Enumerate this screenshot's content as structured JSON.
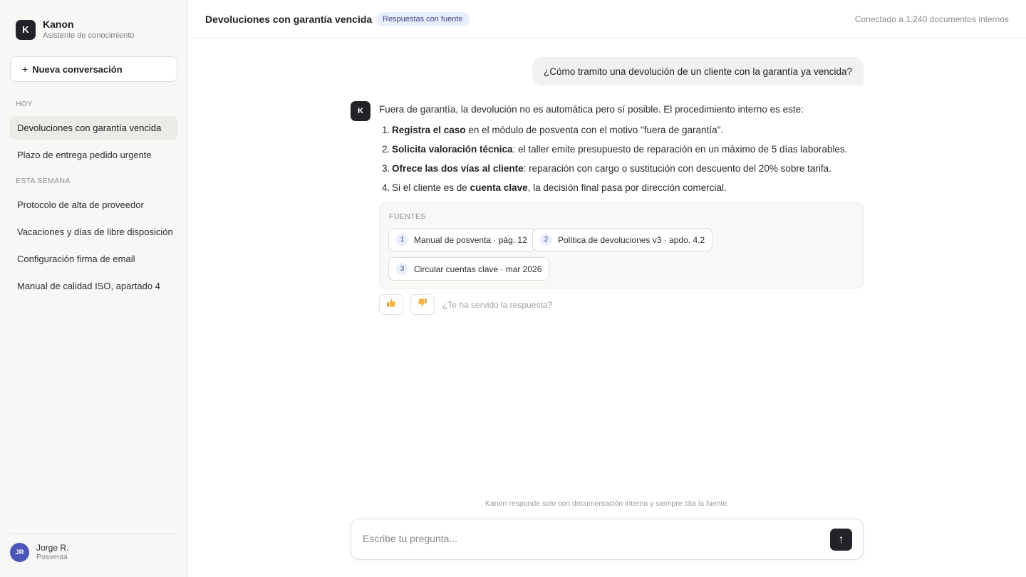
{
  "app": {
    "logo_letter": "K",
    "name": "Kanon",
    "subtitle": "Asistente de conocimiento"
  },
  "sidebar": {
    "new_conversation_plus": "+",
    "new_conversation_label": "Nueva conversación",
    "sections": [
      {
        "label": "HOY",
        "items": [
          {
            "label": "Devoluciones con garantía vencida",
            "active": true
          },
          {
            "label": "Plazo de entrega pedido urgente",
            "active": false
          }
        ]
      },
      {
        "label": "ESTA SEMANA",
        "items": [
          {
            "label": "Protocolo de alta de proveedor",
            "active": false
          },
          {
            "label": "Vacaciones y días de libre disposición",
            "active": false
          },
          {
            "label": "Configuración firma de email",
            "active": false
          },
          {
            "label": "Manual de calidad ISO, apartado 4",
            "active": false
          }
        ]
      }
    ],
    "user": {
      "initials": "JR",
      "name": "Jorge R.",
      "role": "Posventa"
    }
  },
  "header": {
    "title": "Devoluciones con garantía vencida",
    "badge": "Respuestas con fuente",
    "status": "Conectado a 1.240 documentos internos"
  },
  "chat": {
    "user_message": "¿Cómo tramito una devolución de un cliente con la garantía ya vencida?",
    "assistant_avatar": "K",
    "answer_intro": "Fuera de garantía, la devolución no es automática pero sí posible. El procedimiento interno es este:",
    "steps": [
      {
        "num": "1.",
        "bold": "Registra el caso",
        "text": " en el módulo de posventa con el motivo \"fuera de garantía\"."
      },
      {
        "num": "2.",
        "bold": "Solicita valoración técnica",
        "text": ": el taller emite presupuesto de reparación en un máximo de 5 días laborables."
      },
      {
        "num": "3.",
        "bold": "Ofrece las dos vías al cliente",
        "text": ": reparación con cargo o sustitución con descuento del 20% sobre tarifa."
      },
      {
        "num": "4.",
        "pre": "Si el cliente es de ",
        "bold": "cuenta clave",
        "text": ", la decisión final pasa por dirección comercial."
      }
    ],
    "sources_label": "FUENTES",
    "sources": [
      {
        "num": "1",
        "label": "Manual de posventa · pág. 12"
      },
      {
        "num": "2",
        "label": "Política de devoluciones v3 · apdo. 4.2"
      },
      {
        "num": "3",
        "label": "Circular cuentas clave · mar 2026"
      }
    ],
    "feedback_question": "¿Te ha servido la respuesta?",
    "feedback_icons": [
      "thumbs-up-icon",
      "thumbs-down-icon"
    ]
  },
  "composer": {
    "disclaimer": "Kanon responde solo con documentación interna y siempre cita la fuente.",
    "placeholder": "Escribe tu pregunta...",
    "send_symbol": "↑"
  },
  "colors": {
    "accent_dark": "#222328",
    "badge_bg": "#e8eefb",
    "avatar_bg": "#4b56b8",
    "thumb_yellow": "#f2b53a"
  }
}
